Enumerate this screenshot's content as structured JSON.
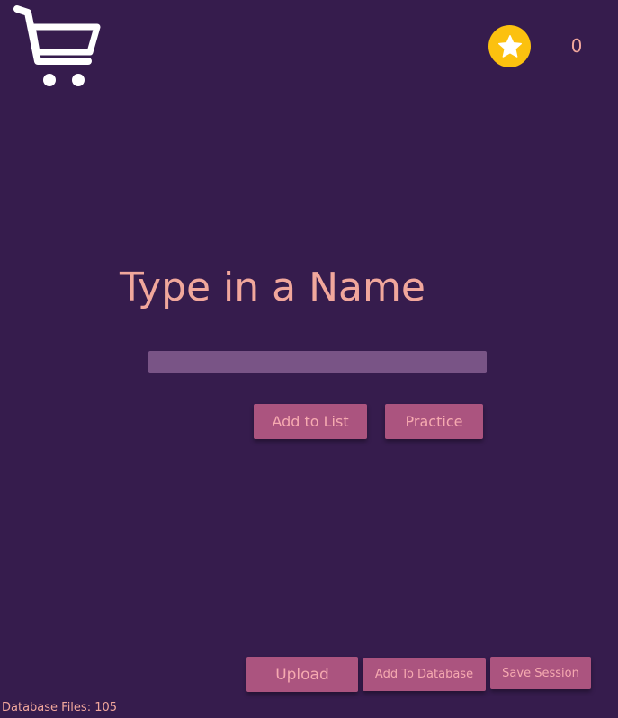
{
  "header": {
    "cart_icon": "shopping-cart-icon",
    "star_icon": "star-icon",
    "score": "0",
    "colors": {
      "star_badge": "#fcc10f",
      "star": "#ffffff"
    }
  },
  "main": {
    "title": "Type in a Name",
    "name_input": {
      "value": "",
      "placeholder": ""
    },
    "add_to_list_label": "Add to List",
    "practice_label": "Practice"
  },
  "footer": {
    "upload_label": "Upload",
    "add_to_database_label": "Add To Database",
    "save_session_label": "Save Session",
    "database_files": "Database Files: 105"
  },
  "theme": {
    "background": "#361c4d",
    "text_accent": "#f1a79c",
    "button": "#ab547f",
    "input": "#795486"
  }
}
